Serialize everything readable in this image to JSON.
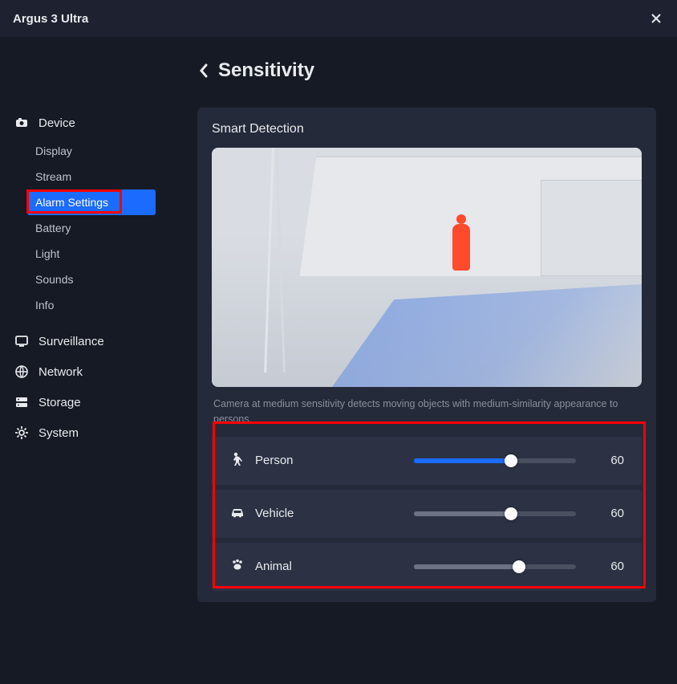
{
  "titlebar": {
    "title": "Argus 3 Ultra"
  },
  "sidebar": {
    "sections": [
      {
        "icon": "camera",
        "label": "Device"
      },
      {
        "icon": "monitor",
        "label": "Surveillance"
      },
      {
        "icon": "globe",
        "label": "Network"
      },
      {
        "icon": "storage",
        "label": "Storage"
      },
      {
        "icon": "gear",
        "label": "System"
      }
    ],
    "device_subs": [
      {
        "label": "Display"
      },
      {
        "label": "Stream"
      },
      {
        "label": "Alarm Settings",
        "active": true
      },
      {
        "label": "Battery"
      },
      {
        "label": "Light"
      },
      {
        "label": "Sounds"
      },
      {
        "label": "Info"
      }
    ]
  },
  "page": {
    "title": "Sensitivity",
    "panel_title": "Smart Detection",
    "caption": "Camera at medium sensitivity detects moving objects with medium-similarity appearance to persons."
  },
  "sliders": [
    {
      "icon": "person",
      "label": "Person",
      "value": 60,
      "fillClass": "blue"
    },
    {
      "icon": "vehicle",
      "label": "Vehicle",
      "value": 60,
      "fillClass": "gray"
    },
    {
      "icon": "animal",
      "label": "Animal",
      "value": 65,
      "displayValue": 60,
      "fillClass": "gray"
    }
  ]
}
